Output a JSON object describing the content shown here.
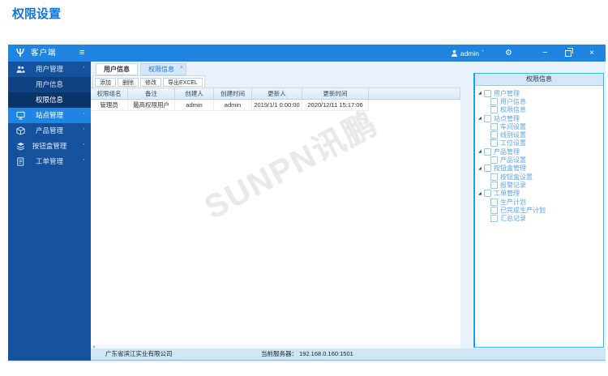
{
  "page": {
    "title": "权限设置"
  },
  "icons": {
    "hamburger": "≡",
    "chevron_down": "˅",
    "chevron_up": "˄",
    "minimize": "–",
    "close": "×",
    "gear": "⚙",
    "tab_close": "×",
    "tree_expanded": "◢"
  },
  "titlebar": {
    "app_name": "客户端",
    "user": "admin"
  },
  "sidebar": {
    "items": [
      {
        "label": "用户管理"
      },
      {
        "label": "用户信息"
      },
      {
        "label": "权限信息"
      },
      {
        "label": "站点管理"
      },
      {
        "label": "产品管理"
      },
      {
        "label": "按钮盒管理"
      },
      {
        "label": "工单管理"
      }
    ]
  },
  "tabs": [
    {
      "label": "用户信息"
    },
    {
      "label": "权限信息",
      "active": true
    }
  ],
  "toolbar": {
    "buttons": [
      "添加",
      "删除",
      "修改",
      "导出EXCEL"
    ]
  },
  "table": {
    "headers": [
      "权限组名",
      "备注",
      "创建人",
      "创建时间",
      "更新人",
      "更新时间"
    ],
    "rows": [
      [
        "管理员",
        "最高权限用户",
        "admin",
        "admin",
        "2019/1/1 0:00:00",
        "2020/12/11 15:17:06"
      ]
    ]
  },
  "watermark": "SUNPN讯鹏",
  "panel": {
    "title": "权限信息",
    "tree": [
      {
        "label": "用户管理"
      },
      {
        "label": "用户信息"
      },
      {
        "label": "权限信息"
      },
      {
        "label": "站点管理"
      },
      {
        "label": "车间设置"
      },
      {
        "label": "线别设置"
      },
      {
        "label": "工位设置"
      },
      {
        "label": "产品管理"
      },
      {
        "label": "产品设置"
      },
      {
        "label": "按钮盒管理"
      },
      {
        "label": "按钮盒设置"
      },
      {
        "label": "报警记录"
      },
      {
        "label": "工单管理"
      },
      {
        "label": "生产计划"
      },
      {
        "label": "已完成生产计划"
      },
      {
        "label": "汇总记录"
      }
    ]
  },
  "statusbar": {
    "company": "广东省滨江实业有限公司",
    "server": "当前服务器： 192.168.0.160:1501"
  },
  "colors": {
    "accent_blue": "#1e86e0",
    "sidebar_blue": "#15529e",
    "panel_border": "#19a3e8",
    "title_blue": "#1373d6"
  }
}
